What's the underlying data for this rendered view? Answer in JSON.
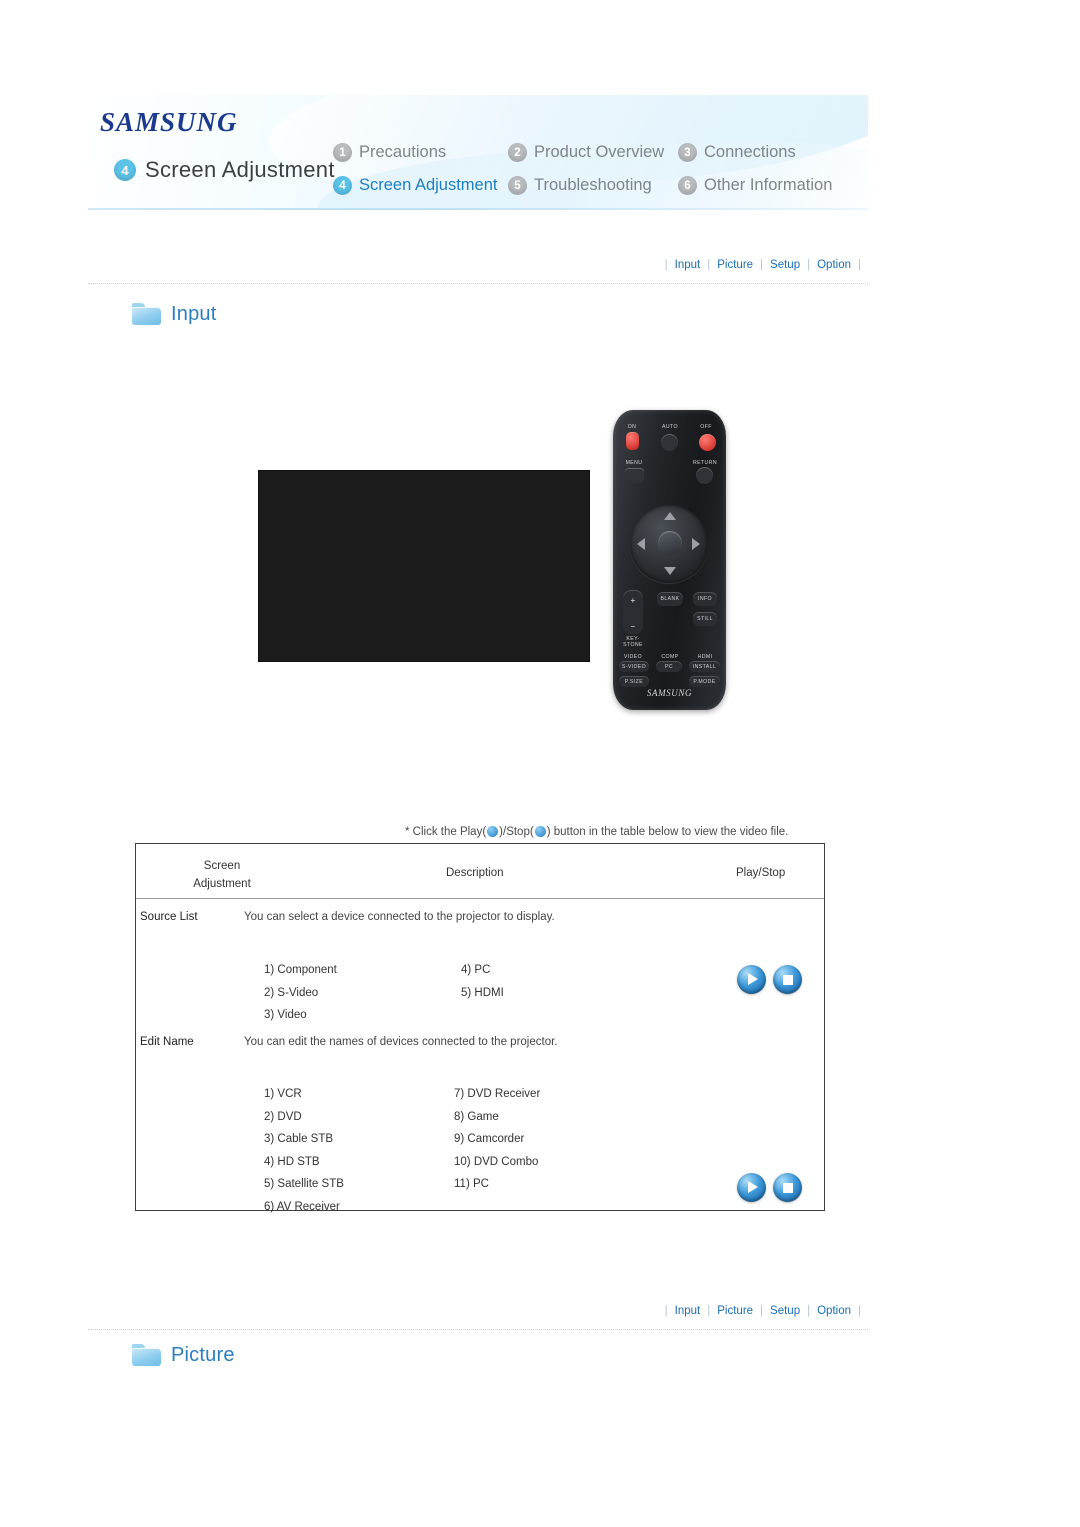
{
  "header": {
    "brand": "SAMSUNG",
    "page_number": "4",
    "page_title": "Screen Adjustment",
    "nav": [
      {
        "num": "1",
        "label": "Precautions",
        "active": false
      },
      {
        "num": "2",
        "label": "Product Overview",
        "active": false
      },
      {
        "num": "3",
        "label": "Connections",
        "active": false
      },
      {
        "num": "4",
        "label": "Screen Adjustment",
        "active": true
      },
      {
        "num": "5",
        "label": "Troubleshooting",
        "active": false
      },
      {
        "num": "6",
        "label": "Other Information",
        "active": false
      }
    ]
  },
  "tablinks": {
    "items": [
      "Input",
      "Picture",
      "Setup",
      "Option"
    ],
    "separator": "|"
  },
  "sections": {
    "input_title": "Input",
    "picture_title": "Picture"
  },
  "note": {
    "prefix": "* Click the Play(",
    "middle": ")/Stop(",
    "suffix": ") button in the table below to view the video file."
  },
  "table": {
    "header": {
      "col1_line1": "Screen",
      "col1_line2": "Adjustment",
      "col2": "Description",
      "col3": "Play/Stop"
    },
    "rows": [
      {
        "label": "Source List",
        "description": "You can select a device connected to the projector to display.",
        "items_col1": [
          "1) Component",
          "2) S-Video",
          "3) Video"
        ],
        "items_col2": [
          "4) PC",
          "5) HDMI"
        ]
      },
      {
        "label": "Edit Name",
        "description": "You can edit the names of devices connected to the projector.",
        "items_col1": [
          "1) VCR",
          "2) DVD",
          "3) Cable STB",
          "4) HD STB",
          "5) Satellite STB",
          "6) AV Receiver"
        ],
        "items_col2": [
          "7) DVD Receiver",
          "8) Game",
          "9) Camcorder",
          "10) DVD Combo",
          "11) PC"
        ]
      }
    ]
  },
  "remote": {
    "brand": "SAMSUNG",
    "labels": {
      "on": "ON",
      "auto": "AUTO",
      "off": "OFF",
      "menu": "MENU",
      "return": "RETURN",
      "keystone": "KEY\nSTONE",
      "blank": "BLANK",
      "info": "INFO",
      "still": "STILL",
      "video": "VIDEO",
      "comp": "COMP",
      "hdmi": "HDMI",
      "svideo": "S-VIDEO",
      "pc": "PC",
      "install": "INSTALL",
      "psize": "P.SIZE",
      "pmode": "P.MODE"
    }
  }
}
